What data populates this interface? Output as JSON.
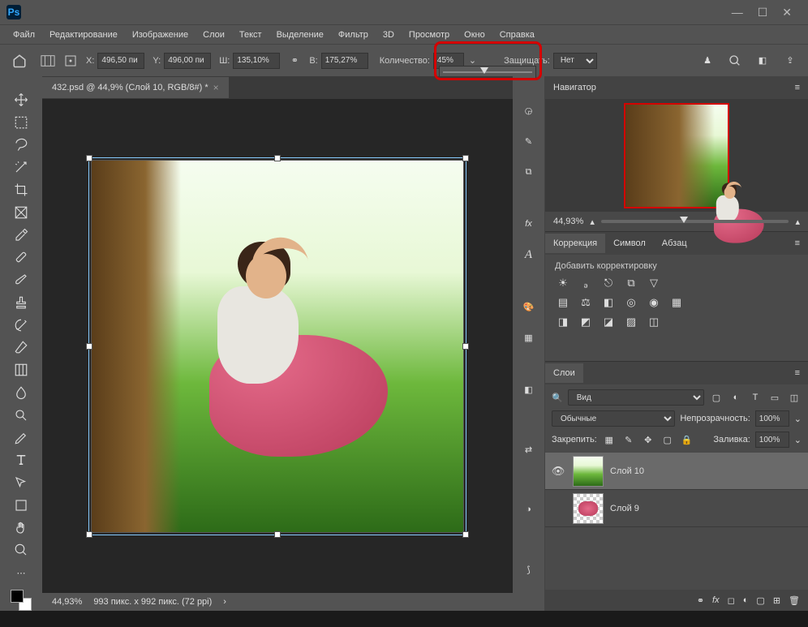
{
  "menu": {
    "file": "Файл",
    "edit": "Редактирование",
    "image": "Изображение",
    "layers": "Слои",
    "text": "Текст",
    "select": "Выделение",
    "filter": "Фильтр",
    "threed": "3D",
    "view": "Просмотр",
    "window": "Окно",
    "help": "Справка"
  },
  "optbar": {
    "x_label": "X:",
    "x_val": "496,50 пи",
    "y_label": "Y:",
    "y_val": "496,00 пи",
    "w_label": "Ш:",
    "w_val": "135,10%",
    "h_label": "В:",
    "h_val": "175,27%",
    "amount_label": "Количество:",
    "amount_val": "45%",
    "protect_label": "Защищать:",
    "protect_val": "Нет"
  },
  "tab": {
    "title": "432.psd @ 44,9% (Слой 10, RGB/8#) *"
  },
  "status": {
    "zoom": "44,93%",
    "info": "993 пикс. x 992 пикс. (72 ppi)"
  },
  "navigator": {
    "title": "Навигатор",
    "zoom": "44,93%"
  },
  "adjustments": {
    "tab1": "Коррекция",
    "tab2": "Символ",
    "tab3": "Абзац",
    "label": "Добавить корректировку"
  },
  "layers": {
    "tab": "Слои",
    "kind": "Вид",
    "blend": "Обычные",
    "opacity_label": "Непрозрачность:",
    "opacity": "100%",
    "lock_label": "Закрепить:",
    "fill_label": "Заливка:",
    "fill": "100%",
    "layer1": "Слой 10",
    "layer2": "Слой 9"
  },
  "search_placeholder": "Вид"
}
